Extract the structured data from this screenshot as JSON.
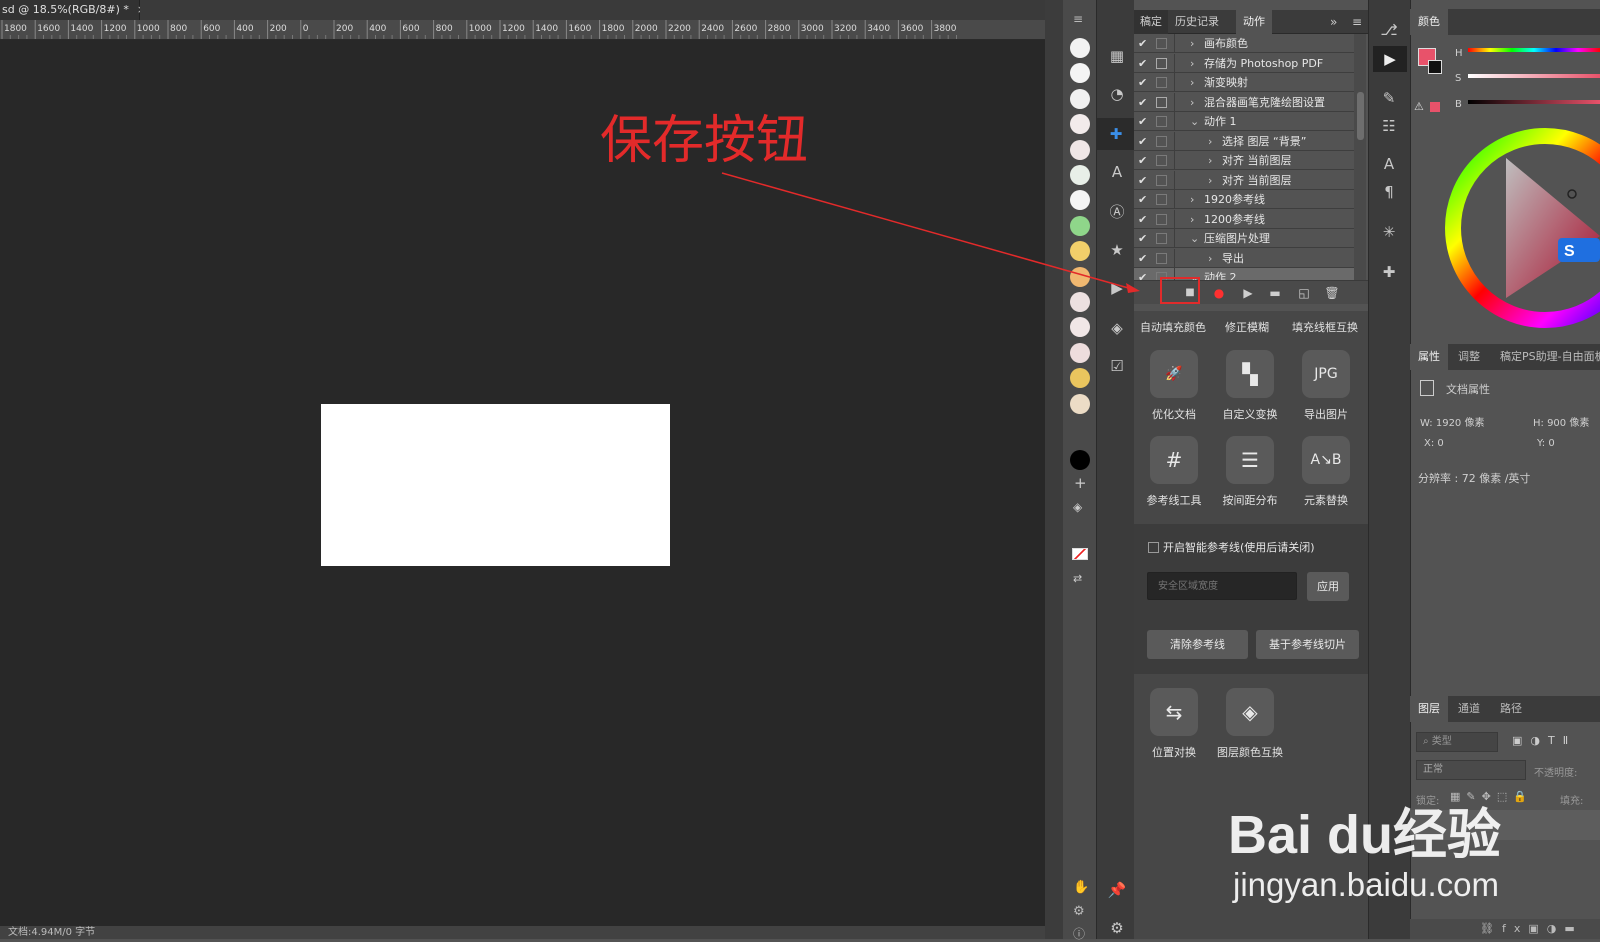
{
  "document": {
    "tab_title": "sd @ 18.5%(RGB/8#) *",
    "tab_close": "×",
    "status_text": "文档:4.94M/0 字节"
  },
  "ruler": {
    "ticks": [
      "1800",
      "1600",
      "1400",
      "1200",
      "1000",
      "800",
      "600",
      "400",
      "200",
      "0",
      "200",
      "400",
      "600",
      "800",
      "1000",
      "1200",
      "1400",
      "1600",
      "1800",
      "2000",
      "2200",
      "2400",
      "2600",
      "2800",
      "3000",
      "3200",
      "3400",
      "3600",
      "3800"
    ]
  },
  "actions_panel": {
    "tabs": [
      "稿定",
      "历史记录",
      "动作"
    ],
    "active_tab": "动作",
    "rows": [
      {
        "label": "画布颜色",
        "expanded": false,
        "indent": 0,
        "dialog": false
      },
      {
        "label": "存储为 Photoshop PDF",
        "expanded": false,
        "indent": 0,
        "dialog": true
      },
      {
        "label": "渐变映射",
        "expanded": false,
        "indent": 0,
        "dialog": false
      },
      {
        "label": "混合器画笔克隆绘图设置",
        "expanded": false,
        "indent": 0,
        "dialog": true
      },
      {
        "label": "动作 1",
        "expanded": true,
        "indent": 0,
        "dialog": false
      },
      {
        "label": "选择 图层 “背景”",
        "expanded": false,
        "indent": 1,
        "dialog": false
      },
      {
        "label": "对齐 当前图层",
        "expanded": false,
        "indent": 1,
        "dialog": false
      },
      {
        "label": "对齐 当前图层",
        "expanded": false,
        "indent": 1,
        "dialog": false
      },
      {
        "label": "1920参考线",
        "expanded": false,
        "indent": 0,
        "dialog": false
      },
      {
        "label": "1200参考线",
        "expanded": false,
        "indent": 0,
        "dialog": false
      },
      {
        "label": "压缩图片处理",
        "expanded": true,
        "indent": 0,
        "dialog": false
      },
      {
        "label": "导出",
        "expanded": false,
        "indent": 1,
        "dialog": false
      },
      {
        "label": "动作 2",
        "expanded": true,
        "indent": 0,
        "dialog": false,
        "selected": true
      }
    ]
  },
  "plugin": {
    "top_links": [
      "自动填充颜色",
      "修正模糊",
      "填充线框互换"
    ],
    "tools": [
      {
        "label": "优化文档",
        "icon": "rocket-icon",
        "glyph": "🚀"
      },
      {
        "label": "自定义变换",
        "icon": "transform-icon",
        "glyph": "▚"
      },
      {
        "label": "导出图片",
        "icon": "jpg-export-icon",
        "glyph": "JPG"
      },
      {
        "label": "参考线工具",
        "icon": "grid-hash-icon",
        "glyph": "#"
      },
      {
        "label": "按间距分布",
        "icon": "distribute-icon",
        "glyph": "☰"
      },
      {
        "label": "元素替换",
        "icon": "swap-icon",
        "glyph": "A↘B"
      }
    ],
    "smart_guides_label": "开启智能参考线(使用后请关闭)",
    "safe_area_placeholder": "安全区域宽度",
    "apply_label": "应用",
    "clear_guides_label": "清除参考线",
    "slice_guides_label": "基于参考线切片",
    "bottom_tools": [
      {
        "label": "位置对换",
        "icon": "position-swap-icon",
        "glyph": "⇆"
      },
      {
        "label": "图层颜色互换",
        "icon": "layer-color-swap-icon",
        "glyph": "◈"
      }
    ]
  },
  "color_panel": {
    "title": "颜色",
    "labels": [
      "H",
      "S",
      "B"
    ],
    "foreground": "#e8526a",
    "background": "#111111"
  },
  "properties_panel": {
    "tabs": [
      "属性",
      "调整",
      "稿定PS助理-自由面板"
    ],
    "doc_props": "文档属性",
    "w": "W:  1920 像素",
    "h": "H:  900 像素",
    "x": "X:  0",
    "y": "Y:  0",
    "resolution": "分辨率 : 72 像素 /英寸"
  },
  "layers_panel": {
    "tabs": [
      "图层",
      "通道",
      "路径"
    ],
    "filter": "类型",
    "blend_mode": "正常",
    "opacity_label": "不透明度:",
    "lock_label": "锁定:",
    "fill_label": "填充:"
  },
  "annotation": {
    "text": "保存按钮",
    "color": "#e32a2a"
  },
  "watermark": {
    "brand": "Bai du经验",
    "url": "jingyan.baidu.com"
  },
  "swatch_colors": [
    "#f2f2f2",
    "#f4f4f4",
    "#f0f0f0",
    "#f2ebeb",
    "#efe6e6",
    "#e8efe8",
    "#f4f4f4",
    "#8fd68a",
    "#f2cf6a",
    "#f0b870",
    "#ece0e0",
    "#f0e6e6",
    "#eedddd",
    "#e9c55e",
    "#ecdcc6"
  ]
}
